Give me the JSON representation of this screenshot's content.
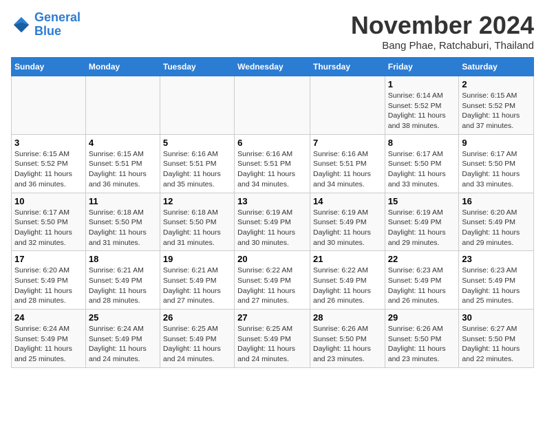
{
  "header": {
    "logo_line1": "General",
    "logo_line2": "Blue",
    "month_title": "November 2024",
    "location": "Bang Phae, Ratchaburi, Thailand"
  },
  "days_of_week": [
    "Sunday",
    "Monday",
    "Tuesday",
    "Wednesday",
    "Thursday",
    "Friday",
    "Saturday"
  ],
  "weeks": [
    [
      {
        "day": "",
        "info": ""
      },
      {
        "day": "",
        "info": ""
      },
      {
        "day": "",
        "info": ""
      },
      {
        "day": "",
        "info": ""
      },
      {
        "day": "",
        "info": ""
      },
      {
        "day": "1",
        "info": "Sunrise: 6:14 AM\nSunset: 5:52 PM\nDaylight: 11 hours and 38 minutes."
      },
      {
        "day": "2",
        "info": "Sunrise: 6:15 AM\nSunset: 5:52 PM\nDaylight: 11 hours and 37 minutes."
      }
    ],
    [
      {
        "day": "3",
        "info": "Sunrise: 6:15 AM\nSunset: 5:52 PM\nDaylight: 11 hours and 36 minutes."
      },
      {
        "day": "4",
        "info": "Sunrise: 6:15 AM\nSunset: 5:51 PM\nDaylight: 11 hours and 36 minutes."
      },
      {
        "day": "5",
        "info": "Sunrise: 6:16 AM\nSunset: 5:51 PM\nDaylight: 11 hours and 35 minutes."
      },
      {
        "day": "6",
        "info": "Sunrise: 6:16 AM\nSunset: 5:51 PM\nDaylight: 11 hours and 34 minutes."
      },
      {
        "day": "7",
        "info": "Sunrise: 6:16 AM\nSunset: 5:51 PM\nDaylight: 11 hours and 34 minutes."
      },
      {
        "day": "8",
        "info": "Sunrise: 6:17 AM\nSunset: 5:50 PM\nDaylight: 11 hours and 33 minutes."
      },
      {
        "day": "9",
        "info": "Sunrise: 6:17 AM\nSunset: 5:50 PM\nDaylight: 11 hours and 33 minutes."
      }
    ],
    [
      {
        "day": "10",
        "info": "Sunrise: 6:17 AM\nSunset: 5:50 PM\nDaylight: 11 hours and 32 minutes."
      },
      {
        "day": "11",
        "info": "Sunrise: 6:18 AM\nSunset: 5:50 PM\nDaylight: 11 hours and 31 minutes."
      },
      {
        "day": "12",
        "info": "Sunrise: 6:18 AM\nSunset: 5:50 PM\nDaylight: 11 hours and 31 minutes."
      },
      {
        "day": "13",
        "info": "Sunrise: 6:19 AM\nSunset: 5:49 PM\nDaylight: 11 hours and 30 minutes."
      },
      {
        "day": "14",
        "info": "Sunrise: 6:19 AM\nSunset: 5:49 PM\nDaylight: 11 hours and 30 minutes."
      },
      {
        "day": "15",
        "info": "Sunrise: 6:19 AM\nSunset: 5:49 PM\nDaylight: 11 hours and 29 minutes."
      },
      {
        "day": "16",
        "info": "Sunrise: 6:20 AM\nSunset: 5:49 PM\nDaylight: 11 hours and 29 minutes."
      }
    ],
    [
      {
        "day": "17",
        "info": "Sunrise: 6:20 AM\nSunset: 5:49 PM\nDaylight: 11 hours and 28 minutes."
      },
      {
        "day": "18",
        "info": "Sunrise: 6:21 AM\nSunset: 5:49 PM\nDaylight: 11 hours and 28 minutes."
      },
      {
        "day": "19",
        "info": "Sunrise: 6:21 AM\nSunset: 5:49 PM\nDaylight: 11 hours and 27 minutes."
      },
      {
        "day": "20",
        "info": "Sunrise: 6:22 AM\nSunset: 5:49 PM\nDaylight: 11 hours and 27 minutes."
      },
      {
        "day": "21",
        "info": "Sunrise: 6:22 AM\nSunset: 5:49 PM\nDaylight: 11 hours and 26 minutes."
      },
      {
        "day": "22",
        "info": "Sunrise: 6:23 AM\nSunset: 5:49 PM\nDaylight: 11 hours and 26 minutes."
      },
      {
        "day": "23",
        "info": "Sunrise: 6:23 AM\nSunset: 5:49 PM\nDaylight: 11 hours and 25 minutes."
      }
    ],
    [
      {
        "day": "24",
        "info": "Sunrise: 6:24 AM\nSunset: 5:49 PM\nDaylight: 11 hours and 25 minutes."
      },
      {
        "day": "25",
        "info": "Sunrise: 6:24 AM\nSunset: 5:49 PM\nDaylight: 11 hours and 24 minutes."
      },
      {
        "day": "26",
        "info": "Sunrise: 6:25 AM\nSunset: 5:49 PM\nDaylight: 11 hours and 24 minutes."
      },
      {
        "day": "27",
        "info": "Sunrise: 6:25 AM\nSunset: 5:49 PM\nDaylight: 11 hours and 24 minutes."
      },
      {
        "day": "28",
        "info": "Sunrise: 6:26 AM\nSunset: 5:50 PM\nDaylight: 11 hours and 23 minutes."
      },
      {
        "day": "29",
        "info": "Sunrise: 6:26 AM\nSunset: 5:50 PM\nDaylight: 11 hours and 23 minutes."
      },
      {
        "day": "30",
        "info": "Sunrise: 6:27 AM\nSunset: 5:50 PM\nDaylight: 11 hours and 22 minutes."
      }
    ]
  ]
}
